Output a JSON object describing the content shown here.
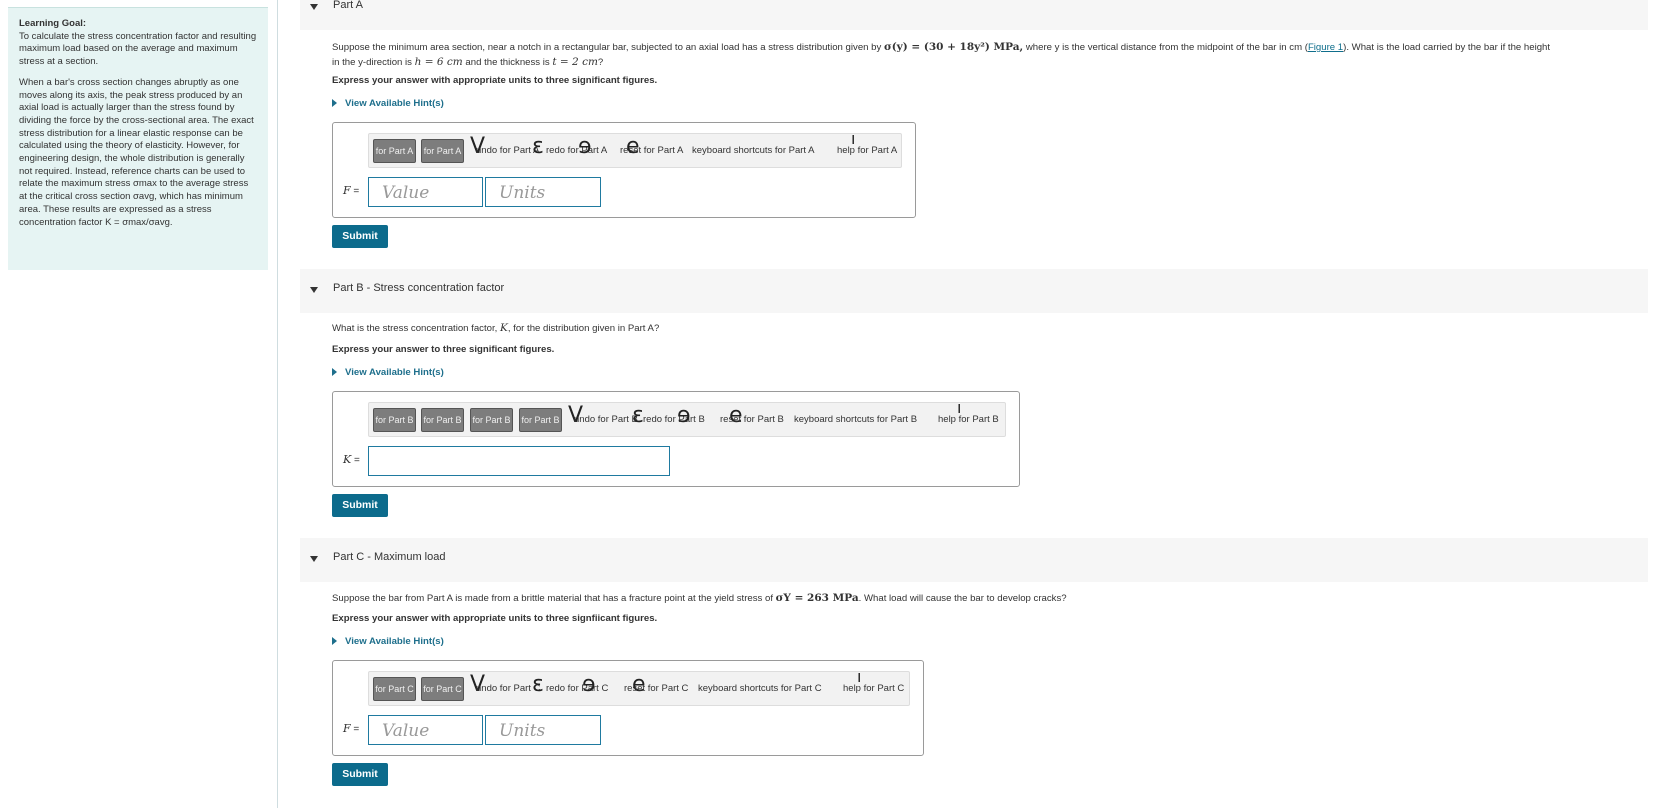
{
  "sidebar": {
    "goal_title": "Learning Goal:",
    "goal_text": "To calculate the stress concentration factor and resulting maximum load based on the average and maximum stress at a section.",
    "body_text": "When a bar's cross section changes abruptly as one moves along its axis, the peak stress produced by an axial load is actually larger than the stress found by dividing the force by the cross-sectional area. The exact stress distribution for a linear elastic response can be calculated using the theory of elasticity. However, for engineering design, the whole distribution is generally not required. Instead, reference charts can be used to relate the maximum stress σmax to the average stress at the critical cross section σavg, which has minimum area. These results are expressed as a stress concentration factor K = σmax/σavg."
  },
  "partA": {
    "title": "Part A",
    "question_line1_a": "Suppose the minimum area section, near a notch in a rectangular bar, subjected to an axial load has a stress distribution given by",
    "question_line1_math": "σ(y) = (30 + 18y²) MPa,",
    "question_line1_b": "where y is the vertical distance from the midpoint of the bar in cm (",
    "figure_link": "Figure 1",
    "question_line1_c": "). What is the load carried by the bar if the height",
    "question_line2_a": "in the y-direction is",
    "question_line2_h": "h = 6 cm",
    "question_line2_b": "and the thickness is",
    "question_line2_t": "t = 2 cm",
    "question_line2_c": "?",
    "instruction": "Express your answer with appropriate units to three significant figures.",
    "hint": "View Available Hint(s)",
    "toolbar": {
      "btn1": "for Part A",
      "btn2": "for Part A",
      "undo": "undo for Part A",
      "redo": "redo for Part A",
      "reset": "reset for Part A",
      "shortcuts": "keyboard shortcuts for Part A",
      "help": "help for Part A"
    },
    "var": "F",
    "value_placeholder": "Value",
    "units_placeholder": "Units",
    "submit": "Submit"
  },
  "partB": {
    "title": "Part B - Stress concentration factor",
    "question_a": "What is the stress concentration factor,",
    "question_k": "K",
    "question_b": ", for the distribution given in Part A?",
    "instruction": "Express your answer to three significant figures.",
    "hint": "View Available Hint(s)",
    "toolbar": {
      "btn1": "for Part B",
      "btn2": "for Part B",
      "btn3": "for Part B",
      "btn4": "for Part B",
      "undo": "undo for Part B",
      "redo": "redo for Part B",
      "reset": "reset for Part B",
      "shortcuts": "keyboard shortcuts for Part B",
      "help": "help for Part B"
    },
    "var": "K",
    "submit": "Submit"
  },
  "partC": {
    "title": "Part C - Maximum load",
    "question_a": "Suppose the bar from Part A is made from a brittle material that has a fracture point at the yield stress of",
    "question_math": "σY = 263 MPa",
    "question_b": ". What load will cause the bar to develop cracks?",
    "instruction": "Express your answer with appropriate units to three signfiicant figures.",
    "hint": "View Available Hint(s)",
    "toolbar": {
      "btn1": "for Part C",
      "btn2": "for Part C",
      "undo": "undo for Part C",
      "redo": "redo for Part C",
      "reset": "reset for Part C",
      "shortcuts": "keyboard shortcuts for Part C",
      "help": "help for Part C"
    },
    "var": "F",
    "value_placeholder": "Value",
    "units_placeholder": "Units",
    "submit": "Submit"
  }
}
